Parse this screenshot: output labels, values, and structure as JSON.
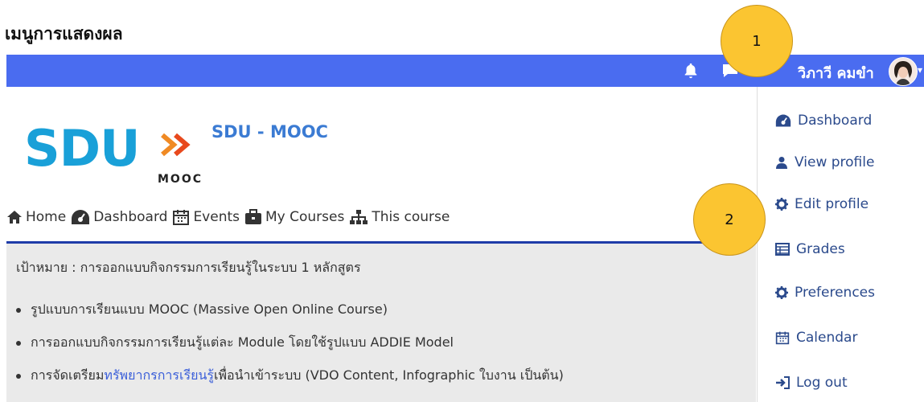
{
  "doc_heading": "เมนูการแสดงผล",
  "topbar": {
    "username": "วิภาวี คมขำ",
    "colors": {
      "bar": "#4a6cf0",
      "text": "#ffffff"
    }
  },
  "site": {
    "logo_text": "SDU",
    "logo_sub": "MOOC",
    "name": "SDU - MOOC"
  },
  "nav": [
    {
      "label": "Home",
      "icon": "home-icon"
    },
    {
      "label": "Dashboard",
      "icon": "dashboard-icon"
    },
    {
      "label": "Events",
      "icon": "calendar-icon"
    },
    {
      "label": "My Courses",
      "icon": "briefcase-icon"
    },
    {
      "label": "This course",
      "icon": "sitemap-icon"
    }
  ],
  "content": {
    "objective": "เป้าหมาย : การออกแบบกิจกรรมการเรียนรู้ในระบบ 1 หลักสูตร",
    "bullets": [
      {
        "text": "รูปแบบการเรียนแบบ MOOC (Massive Open Online Course)"
      },
      {
        "text": "การออกแบบกิจกรรมการเรียนรู้แต่ละ Module โดยใช้รูปแบบ ADDIE Model"
      },
      {
        "pre": "การจัดเตรียม",
        "link": "ทรัพยากรการเรียนรู้",
        "post": "เพื่อนำเข้าระบบ (VDO Content, Infographic ใบงาน เป็นต้น)"
      }
    ]
  },
  "dropdown": [
    {
      "label": "Dashboard",
      "icon": "dashboard-icon"
    },
    {
      "label": "View profile",
      "icon": "user-icon"
    },
    {
      "label": "Edit profile",
      "icon": "cog-icon"
    },
    {
      "label": "Grades",
      "icon": "table-icon"
    },
    {
      "label": "Preferences",
      "icon": "cog-icon"
    },
    {
      "label": "Calendar",
      "icon": "calendar-icon"
    },
    {
      "label": "Log out",
      "icon": "logout-icon"
    }
  ],
  "callouts": [
    {
      "number": "1"
    },
    {
      "number": "2"
    }
  ]
}
